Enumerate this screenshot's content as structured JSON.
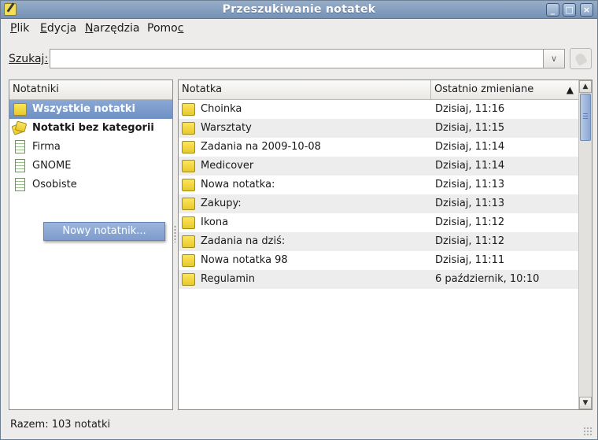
{
  "window": {
    "title": "Przeszukiwanie notatek",
    "controls": [
      "_",
      "□",
      "×"
    ]
  },
  "menu": [
    {
      "label": "Plik",
      "mnemonic_index": 0
    },
    {
      "label": "Edycja",
      "mnemonic_index": 0
    },
    {
      "label": "Narzędzia",
      "mnemonic_index": 0
    },
    {
      "label": "Pomoc",
      "mnemonic_index": 4
    }
  ],
  "search": {
    "label": "Szukaj:",
    "value": "",
    "placeholder": ""
  },
  "notebooks": {
    "header": "Notatniki",
    "items": [
      {
        "label": "Wszystkie notatki",
        "icon": "note-icon",
        "bold": true,
        "selected": true
      },
      {
        "label": "Notatki bez kategorii",
        "icon": "uncategorized-notes-icon",
        "bold": true,
        "selected": false
      },
      {
        "label": "Firma",
        "icon": "notebook-icon",
        "bold": false,
        "selected": false
      },
      {
        "label": "GNOME",
        "icon": "notebook-icon",
        "bold": false,
        "selected": false
      },
      {
        "label": "Osobiste",
        "icon": "notebook-icon",
        "bold": false,
        "selected": false
      }
    ],
    "new_button_label": "Nowy notatnik..."
  },
  "notes": {
    "columns": [
      "Notatka",
      "Ostatnio zmieniane"
    ],
    "sort_indicator": "▲",
    "rows": [
      {
        "title": "Choinka",
        "modified": "Dzisiaj, 11:16"
      },
      {
        "title": "Warsztaty",
        "modified": "Dzisiaj, 11:15"
      },
      {
        "title": "Zadania na 2009-10-08",
        "modified": "Dzisiaj, 11:14"
      },
      {
        "title": "Medicover",
        "modified": "Dzisiaj, 11:14"
      },
      {
        "title": "Nowa notatka:",
        "modified": "Dzisiaj, 11:13"
      },
      {
        "title": "Zakupy:",
        "modified": "Dzisiaj, 11:13"
      },
      {
        "title": "Ikona",
        "modified": "Dzisiaj, 11:12"
      },
      {
        "title": "Zadania na dziś:",
        "modified": "Dzisiaj, 11:12"
      },
      {
        "title": "Nowa notatka 98",
        "modified": "Dzisiaj, 11:11"
      },
      {
        "title": "Regulamin",
        "modified": "6 październik, 10:10"
      }
    ]
  },
  "status": {
    "text": "Razem: 103 notatki"
  },
  "colors": {
    "titlebar": "#7f9abd",
    "selection": "#7a98c9",
    "note_icon": "#f2d84a"
  }
}
